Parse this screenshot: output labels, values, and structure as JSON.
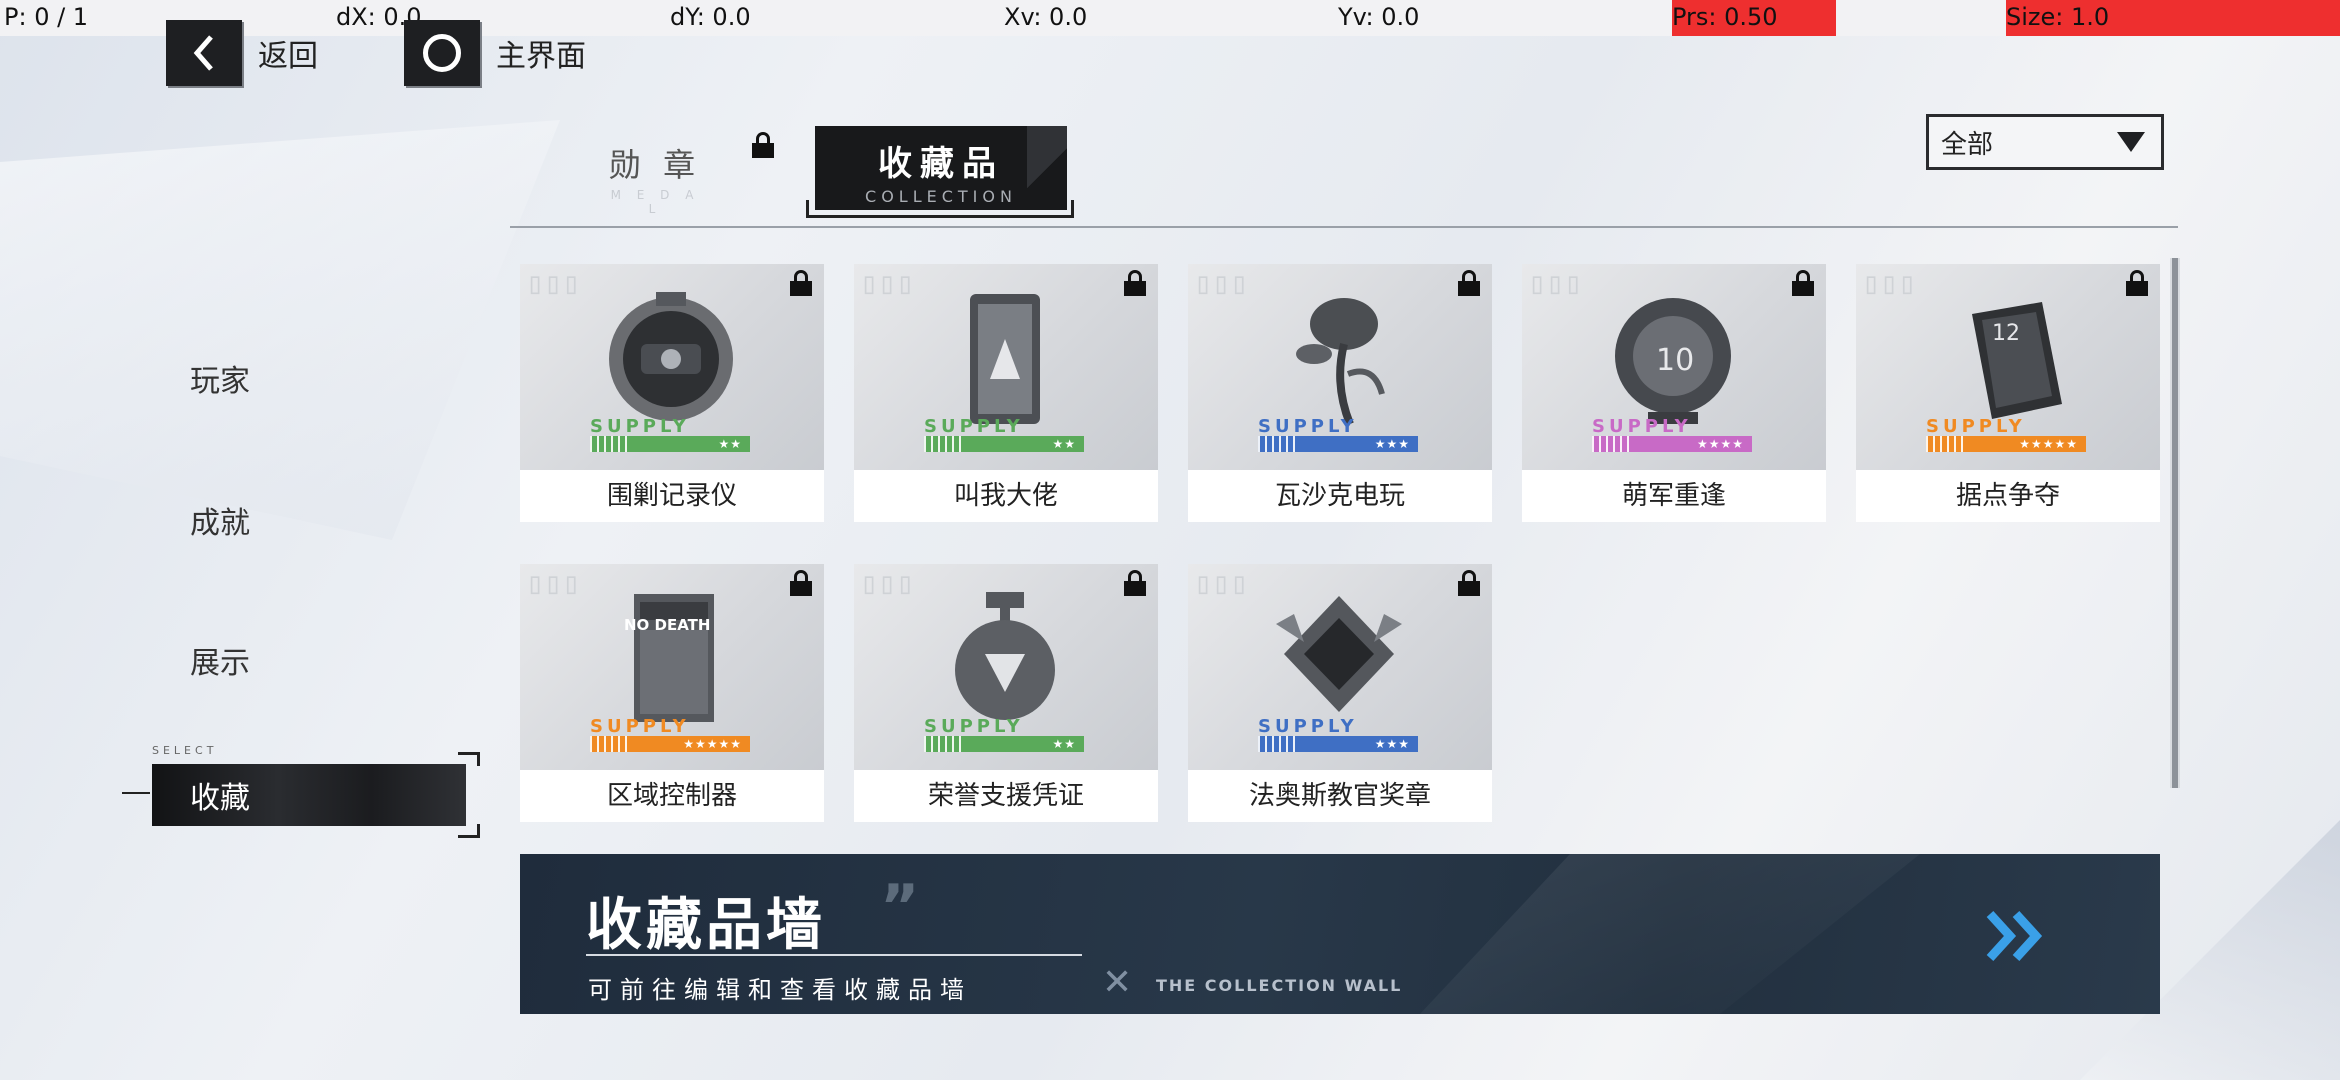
{
  "debug": {
    "p": "P: 0 / 1",
    "dx": "dX: 0.0",
    "dy": "dY: 0.0",
    "xv": "Xv: 0.0",
    "yv": "Yv: 0.0",
    "prs": "Prs: 0.50",
    "size": "Size: 1.0",
    "highlight_color": "#ee2f2f"
  },
  "nav": {
    "back_label": "返回",
    "home_label": "主界面"
  },
  "tabs": {
    "medal": {
      "label": "勋 章",
      "sub": "M E D A L",
      "locked": true
    },
    "collection": {
      "label": "收藏品",
      "sub": "COLLECTION",
      "active": true
    }
  },
  "filter": {
    "selected": "全部"
  },
  "sidebar": {
    "items": [
      {
        "label": "玩家"
      },
      {
        "label": "成就"
      },
      {
        "label": "展示"
      },
      {
        "label": "收藏",
        "active": true
      }
    ],
    "select_tag": "SELECT"
  },
  "collection": {
    "supply_label": "SUPPLY",
    "items": [
      {
        "name": "围剿记录仪",
        "stars": "★★",
        "rarity_color": "#5aaa5a",
        "locked": true,
        "icon": "recorder-icon"
      },
      {
        "name": "叫我大佬",
        "stars": "★★",
        "rarity_color": "#5aaa5a",
        "locked": true,
        "icon": "card-icon"
      },
      {
        "name": "瓦沙克电玩",
        "stars": "★★★",
        "rarity_color": "#3f6fc4",
        "locked": true,
        "icon": "plant-icon"
      },
      {
        "name": "萌军重逢",
        "stars": "★★★★",
        "rarity_color": "#c86ac6",
        "locked": true,
        "icon": "globe-icon"
      },
      {
        "name": "据点争夺",
        "stars": "★★★★★",
        "rarity_color": "#f08a22",
        "locked": true,
        "icon": "book-icon"
      },
      {
        "name": "区域控制器",
        "stars": "★★★★★",
        "rarity_color": "#f08a22",
        "locked": true,
        "icon": "poster-icon",
        "art_text": "NO DEATH"
      },
      {
        "name": "荣誉支援凭证",
        "stars": "★★",
        "rarity_color": "#5aaa5a",
        "locked": true,
        "icon": "medal-icon"
      },
      {
        "name": "法奥斯教官奖章",
        "stars": "★★★",
        "rarity_color": "#3f6fc4",
        "locked": true,
        "icon": "badge-icon"
      }
    ]
  },
  "banner": {
    "title": "收藏品墙",
    "subtitle": "可前往编辑和查看收藏品墙",
    "en": "THE COLLECTION WALL",
    "arrow_color": "#3aa0e8"
  }
}
